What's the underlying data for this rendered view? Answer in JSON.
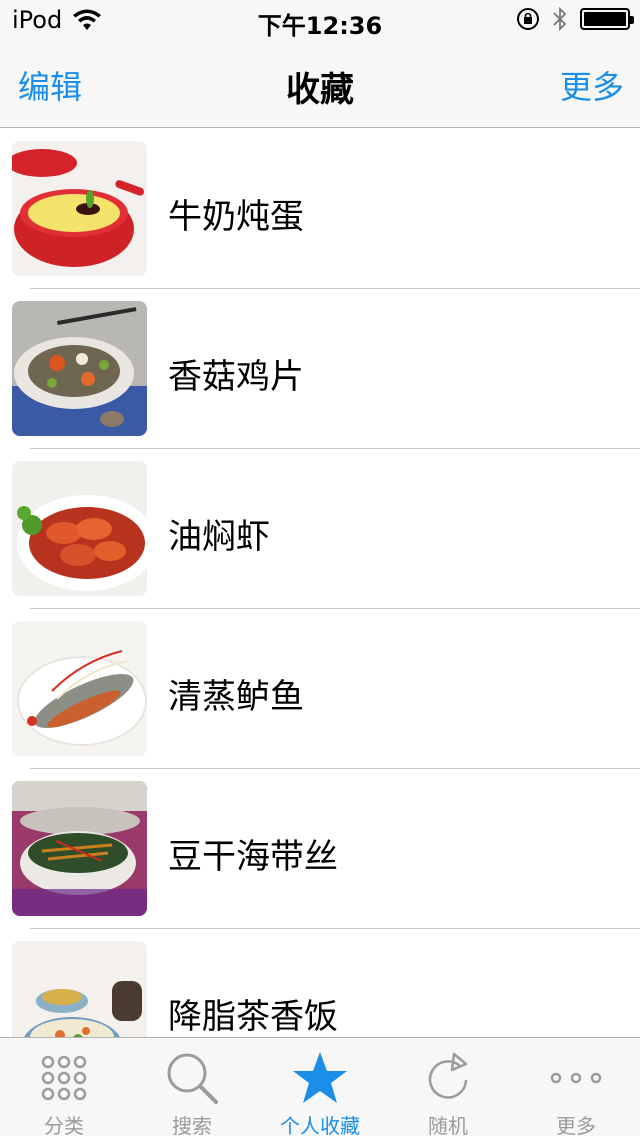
{
  "status_bar": {
    "device": "iPod",
    "time": "下午12:36"
  },
  "nav": {
    "left": "编辑",
    "title": "收藏",
    "right": "更多"
  },
  "favorites": [
    {
      "name": "牛奶炖蛋",
      "icon": "steamed-milk-egg-photo"
    },
    {
      "name": "香菇鸡片",
      "icon": "mushroom-chicken-photo"
    },
    {
      "name": "油焖虾",
      "icon": "braised-shrimp-photo"
    },
    {
      "name": "清蒸鲈鱼",
      "icon": "steamed-bass-photo"
    },
    {
      "name": "豆干海带丝",
      "icon": "tofu-kelp-salad-photo"
    },
    {
      "name": "降脂茶香饭",
      "icon": "tea-rice-photo"
    }
  ],
  "tabs": [
    {
      "label": "分类",
      "icon": "grid-dots-icon",
      "active": false
    },
    {
      "label": "搜索",
      "icon": "search-icon",
      "active": false
    },
    {
      "label": "个人收藏",
      "icon": "star-icon",
      "active": true
    },
    {
      "label": "随机",
      "icon": "refresh-icon",
      "active": false
    },
    {
      "label": "更多",
      "icon": "more-dots-icon",
      "active": false
    }
  ],
  "colors": {
    "accent": "#1a8ee8",
    "tab_inactive": "#9b9b9b",
    "bar_background": "#f7f7f7"
  }
}
